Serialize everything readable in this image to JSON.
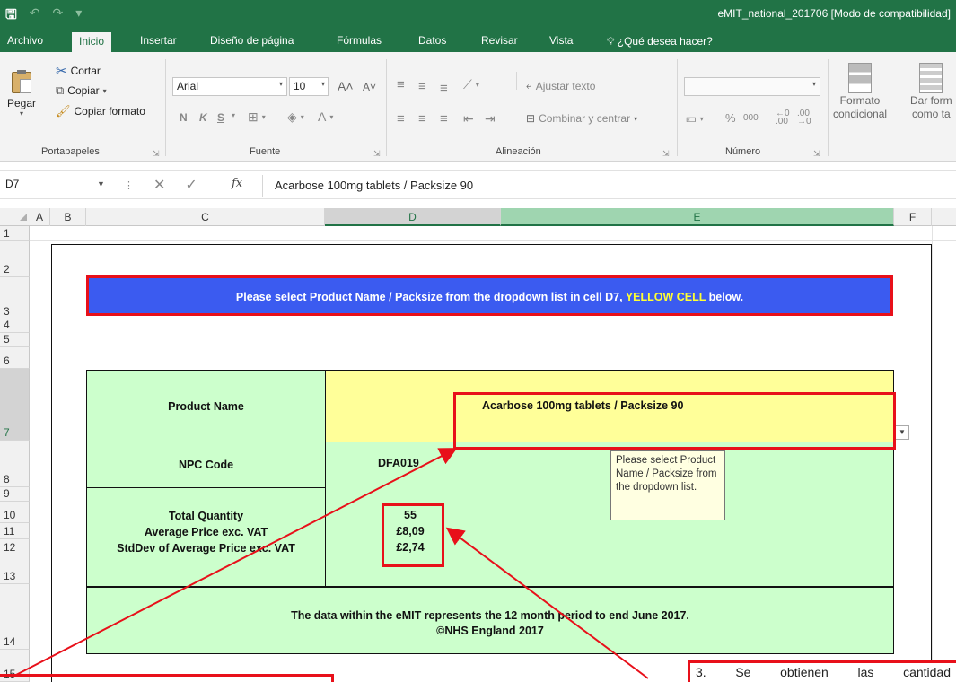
{
  "window": {
    "title": "eMIT_national_201706  [Modo de compatibilidad]"
  },
  "menu": {
    "tabs": [
      "Archivo",
      "Inicio",
      "Insertar",
      "Diseño de página",
      "Fórmulas",
      "Datos",
      "Revisar",
      "Vista"
    ],
    "active_tab": "Inicio",
    "search": "¿Qué desea hacer?"
  },
  "ribbon": {
    "clipboard": {
      "paste": "Pegar",
      "cut": "Cortar",
      "copy": "Copiar",
      "format_painter": "Copiar formato",
      "group_label": "Portapapeles"
    },
    "font": {
      "family": "Arial",
      "size": "10",
      "bold": "N",
      "italic": "K",
      "underline": "S",
      "group_label": "Fuente"
    },
    "alignment": {
      "wrap": "Ajustar texto",
      "merge": "Combinar y centrar",
      "group_label": "Alineación"
    },
    "number": {
      "format_value": "",
      "percent": "%",
      "thousands": "000",
      "group_label": "Número"
    },
    "styles": {
      "conditional_line1": "Formato",
      "conditional_line2": "condicional",
      "table_line1": "Dar form",
      "table_line2": "como ta"
    }
  },
  "formula_bar": {
    "name_box": "D7",
    "fx": "fx",
    "content": "Acarbose 100mg tablets  /  Packsize 90"
  },
  "columns": [
    "A",
    "B",
    "C",
    "D",
    "E",
    "F"
  ],
  "rows": [
    "1",
    "2",
    "3",
    "4",
    "5",
    "6",
    "7",
    "8",
    "9",
    "10",
    "11",
    "12",
    "13",
    "14",
    "15"
  ],
  "sheet": {
    "instruction_prefix": "Please select Product Name / Packsize from the dropdown list in cell D7, ",
    "instruction_highlight": "YELLOW CELL",
    "instruction_suffix": " below.",
    "product_name_label": "Product Name",
    "product_name_value": "Acarbose 100mg tablets  /  Packsize 90",
    "npc_label": "NPC Code",
    "npc_value": "DFA019",
    "total_quantity_label": "Total Quantity",
    "avg_price_label": "Average Price exc. VAT",
    "stddev_label": "StdDev of Average Price exc. VAT",
    "total_quantity_value": "55",
    "avg_price_value": "£8,09",
    "stddev_value": "£2,74",
    "footer_line1": "The data within the eMIT represents the 12 month period to end June 2017.",
    "footer_line2": "©NHS England 2017",
    "tooltip": "Please select Product Name / Packsize from the dropdown list."
  },
  "annotation": {
    "note_fragment_number": "3.",
    "note_fragment_word1": "Se",
    "note_fragment_word2": "obtienen",
    "note_fragment_word3": "las",
    "note_fragment_word4": "cantidad"
  },
  "colors": {
    "excel_green": "#217346",
    "instruction_blue": "#3b5bf0",
    "highlight_red": "#e8101a",
    "cell_green": "#ccffcc",
    "cell_yellow": "#ffff99"
  }
}
